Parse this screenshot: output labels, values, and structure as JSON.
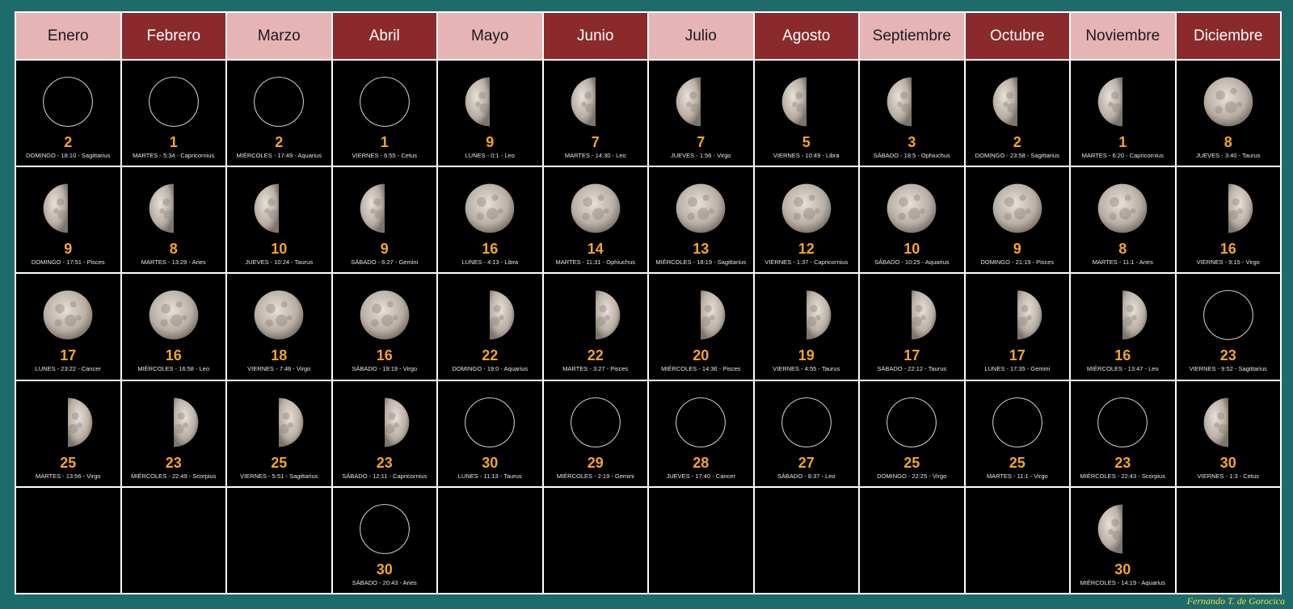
{
  "months": [
    "Enero",
    "Febrero",
    "Marzo",
    "Abril",
    "Mayo",
    "Junio",
    "Julio",
    "Agosto",
    "Septiembre",
    "Octubre",
    "Noviembre",
    "Diciembre"
  ],
  "colors": {
    "header_light": "#e6b4b5",
    "header_dark": "#8a2a2c",
    "day_number": "#f5a623",
    "background": "#1e6b6b",
    "credit": "#f0e040"
  },
  "grid": [
    [
      {
        "phase": "new",
        "day": "2",
        "info": "DOMINGO - 18:10 - Sagittarius"
      },
      {
        "phase": "new",
        "day": "1",
        "info": "MARTES - 5:34 - Capricornius"
      },
      {
        "phase": "new",
        "day": "2",
        "info": "MIÉRCOLES - 17:49 - Aquarius"
      },
      {
        "phase": "new",
        "day": "1",
        "info": "VIERNES - 6:55 - Cetus"
      },
      {
        "phase": "first",
        "day": "9",
        "info": "LUNES - 0:1 - Leo"
      },
      {
        "phase": "first",
        "day": "7",
        "info": "MARTES - 14:30 - Leo"
      },
      {
        "phase": "first",
        "day": "7",
        "info": "JUEVES - 1:56 - Virgo"
      },
      {
        "phase": "first",
        "day": "5",
        "info": "VIERNES - 10:49 - Libra"
      },
      {
        "phase": "first",
        "day": "3",
        "info": "SÁBADO - 18:5 - Ophiuchus"
      },
      {
        "phase": "first",
        "day": "2",
        "info": "DOMINGO - 23:58 - Sagittarius"
      },
      {
        "phase": "first",
        "day": "1",
        "info": "MARTES - 6:20 - Capricornius"
      },
      {
        "phase": "full",
        "day": "8",
        "info": "JUEVES - 3:40 - Taurus"
      }
    ],
    [
      {
        "phase": "first",
        "day": "9",
        "info": "DOMINGO - 17:51 - Pisces"
      },
      {
        "phase": "first",
        "day": "8",
        "info": "MARTES - 13:29 - Aries"
      },
      {
        "phase": "first",
        "day": "10",
        "info": "JUEVES - 10:24 - Taurus"
      },
      {
        "phase": "first",
        "day": "9",
        "info": "SÁBADO - 6:27 - Gemini"
      },
      {
        "phase": "full",
        "day": "16",
        "info": "LUNES - 4:13 - Libra"
      },
      {
        "phase": "full",
        "day": "14",
        "info": "MARTES - 11:31 - Ophiuchus"
      },
      {
        "phase": "full",
        "day": "13",
        "info": "MIÉRCOLES - 18:19 - Sagittarius"
      },
      {
        "phase": "full",
        "day": "12",
        "info": "VIERNES - 1:37 - Capricornius"
      },
      {
        "phase": "full",
        "day": "10",
        "info": "SÁBADO - 10:25 - Aquarius"
      },
      {
        "phase": "full",
        "day": "9",
        "info": "DOMINGO - 21:19 - Pisces"
      },
      {
        "phase": "full",
        "day": "8",
        "info": "MARTES - 11:1 - Aries"
      },
      {
        "phase": "last",
        "day": "16",
        "info": "VIERNES - 9:15 - Virgo"
      }
    ],
    [
      {
        "phase": "full",
        "day": "17",
        "info": "LUNES - 23:22 - Cancer"
      },
      {
        "phase": "full",
        "day": "16",
        "info": "MIÉRCOLES - 16:58 - Leo"
      },
      {
        "phase": "full",
        "day": "18",
        "info": "VIERNES - 7:46 - Virgo"
      },
      {
        "phase": "full",
        "day": "16",
        "info": "SÁBADO - 19:19 - Virgo"
      },
      {
        "phase": "last",
        "day": "22",
        "info": "DOMINGO - 19:0 - Aquarius"
      },
      {
        "phase": "last",
        "day": "22",
        "info": "MARTES - 3:27 - Pisces"
      },
      {
        "phase": "last",
        "day": "20",
        "info": "MIÉRCOLES - 14:36 - Pisces"
      },
      {
        "phase": "last",
        "day": "19",
        "info": "VIERNES - 4:55 - Taurus"
      },
      {
        "phase": "last",
        "day": "17",
        "info": "SÁBADO - 22:12 - Taurus"
      },
      {
        "phase": "last",
        "day": "17",
        "info": "LUNES - 17:35 - Gemini"
      },
      {
        "phase": "last",
        "day": "16",
        "info": "MIÉRCOLES - 13:47 - Leo"
      },
      {
        "phase": "new",
        "day": "23",
        "info": "VIERNES - 9:52 - Sagittarius"
      }
    ],
    [
      {
        "phase": "last",
        "day": "25",
        "info": "MARTES - 13:56 - Virgo"
      },
      {
        "phase": "last",
        "day": "23",
        "info": "MIÉRCOLES - 22:49 - Scorpius"
      },
      {
        "phase": "last",
        "day": "25",
        "info": "VIERNES - 5:51 - Sagittarius"
      },
      {
        "phase": "last",
        "day": "23",
        "info": "SÁBADO - 12:11 - Capricornius"
      },
      {
        "phase": "new",
        "day": "30",
        "info": "LUNES - 11:13 - Taurus"
      },
      {
        "phase": "new",
        "day": "29",
        "info": "MIÉRCOLES - 2:19 - Gemini"
      },
      {
        "phase": "new",
        "day": "28",
        "info": "JUEVES - 17:40 - Cancer"
      },
      {
        "phase": "new",
        "day": "27",
        "info": "SÁBADO - 8:37 - Leo"
      },
      {
        "phase": "new",
        "day": "25",
        "info": "DOMINGO - 22:25 - Virgo"
      },
      {
        "phase": "new",
        "day": "25",
        "info": "MARTES - 11:1 - Virgo"
      },
      {
        "phase": "new",
        "day": "23",
        "info": "MIÉRCOLES - 22:43 - Scorpius"
      },
      {
        "phase": "first",
        "day": "30",
        "info": "VIERNES - 1:3 - Cetus"
      }
    ],
    [
      null,
      null,
      null,
      {
        "phase": "new",
        "day": "30",
        "info": "SÁBADO - 20:43 - Aries"
      },
      null,
      null,
      null,
      null,
      null,
      null,
      {
        "phase": "first",
        "day": "30",
        "info": "MIÉRCOLES - 14:19 - Aquarius"
      },
      null
    ]
  ],
  "credit": "Fernando T. de Gorocica"
}
